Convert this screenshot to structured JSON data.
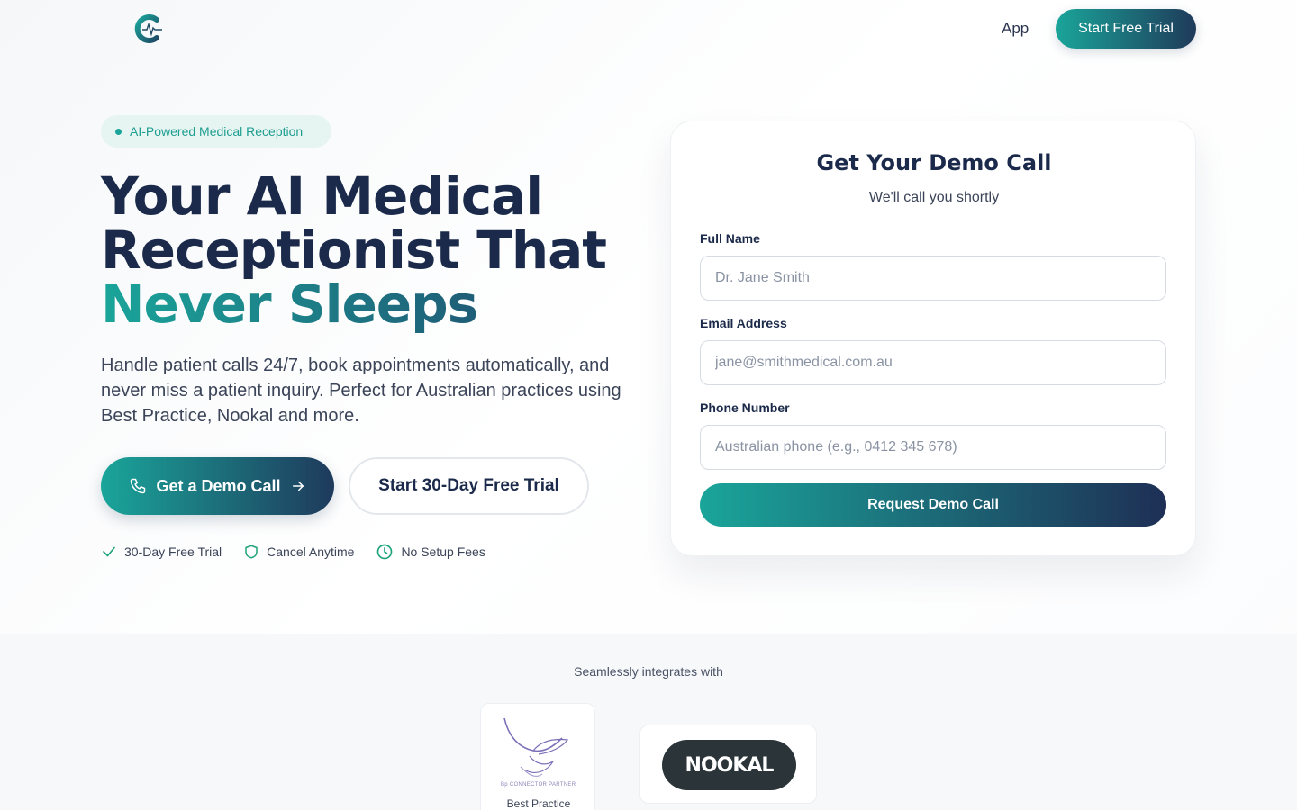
{
  "nav": {
    "app_label": "App",
    "cta_label": "Start Free Trial"
  },
  "hero": {
    "badge": "AI-Powered Medical Reception",
    "title_line1": "Your AI Medical",
    "title_line2": "Receptionist That",
    "title_accent": "Never Sleeps",
    "subtitle": "Handle patient calls 24/7, book appointments automatically, and never miss a patient inquiry. Perfect for Australian practices using Best Practice, Nookal and more.",
    "demo_button": "Get a Demo Call",
    "trial_button": "Start 30-Day Free Trial",
    "perks": [
      {
        "label": "30-Day Free Trial",
        "icon": "check-icon"
      },
      {
        "label": "Cancel Anytime",
        "icon": "shield-icon"
      },
      {
        "label": "No Setup Fees",
        "icon": "clock-icon"
      }
    ]
  },
  "form": {
    "title": "Get Your Demo Call",
    "subtitle": "We'll call you shortly",
    "name_label": "Full Name",
    "name_placeholder": "Dr. Jane Smith",
    "email_label": "Email Address",
    "email_placeholder": "jane@smithmedical.com.au",
    "phone_label": "Phone Number",
    "phone_placeholder": "Australian phone (e.g., 0412 345 678)",
    "submit_label": "Request Demo Call"
  },
  "integrations": {
    "label": "Seamlessly integrates with",
    "best_practice": {
      "caption": "Best Practice",
      "small_text": "Bp CONNECTOR PARTNER"
    },
    "nookal": {
      "logo_text": "NOOKAL"
    }
  },
  "colors": {
    "teal": "#1aa59a",
    "navy": "#1b2a4a",
    "badge_bg": "#e6f5f2"
  }
}
